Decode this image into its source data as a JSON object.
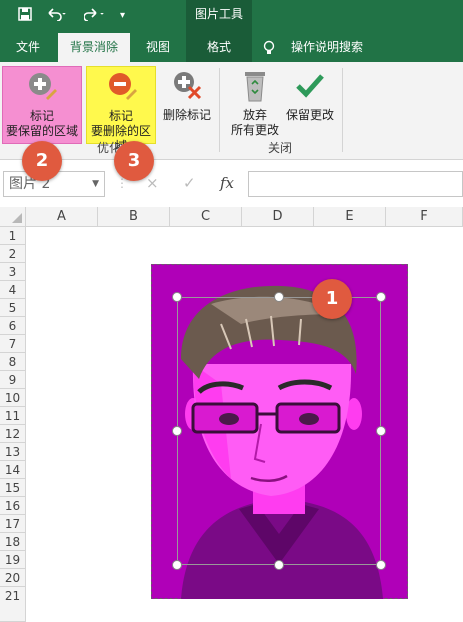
{
  "titlebar": {
    "save_icon": "save-icon",
    "undo_icon": "undo-icon",
    "redo_icon": "redo-icon",
    "customize_icon": "customize-qat-icon",
    "context_group": "图片工具"
  },
  "tabs": {
    "file": "文件",
    "background_removal": "背景消除",
    "view": "视图",
    "format": "格式",
    "tell_me": "操作说明搜索",
    "tell_me_icon": "lightbulb-icon"
  },
  "ribbon": {
    "mark_keep_line1": "标记",
    "mark_keep_line2": "要保留的区域",
    "mark_remove_line1": "标记",
    "mark_remove_line2": "要删除的区域",
    "delete_mark": "删除标记",
    "discard_line1": "放弃",
    "discard_line2": "所有更改",
    "keep_changes": "保留更改",
    "group_refine": "优化",
    "group_close": "关闭",
    "colors": {
      "keep_highlight": "#f58fd1",
      "remove_highlight": "#fff94d",
      "badge": "#e05a3f",
      "accent": "#217346"
    }
  },
  "badges": {
    "b1": "1",
    "b2": "2",
    "b3": "3"
  },
  "formula_bar": {
    "name_box": "图片 2",
    "cancel_icon": "×",
    "enter_icon": "✓",
    "fx_label": "fx",
    "value": ""
  },
  "columns": [
    "A",
    "B",
    "C",
    "D",
    "E",
    "F"
  ],
  "rows": [
    "1",
    "2",
    "3",
    "4",
    "5",
    "6",
    "7",
    "8",
    "9",
    "10",
    "11",
    "12",
    "13",
    "14",
    "15",
    "16",
    "17",
    "18",
    "19",
    "20",
    "21"
  ],
  "picture": {
    "background_color": "#b000b8"
  }
}
